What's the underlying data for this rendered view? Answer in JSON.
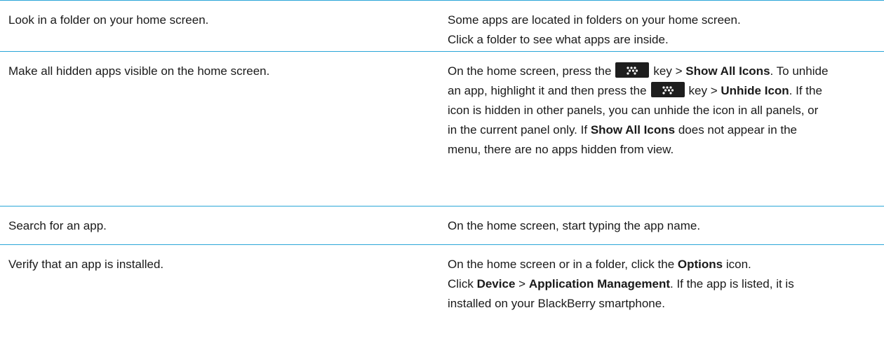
{
  "rows": [
    {
      "task": "Look in a folder on your home screen.",
      "how_l1": "Some apps are located in folders on your home screen.",
      "how_l2": "Click a folder to see what apps are inside."
    },
    {
      "task": "Make all hidden apps visible on the home screen.",
      "p1": "On the home screen, press the",
      "p2": "key >",
      "p3": "Show All Icons",
      "p4": ". To unhide an app, highlight it and then press the",
      "p5": "key >",
      "p6": "Unhide Icon",
      "p7": ". If the icon is hidden in other panels, you can unhide the icon in all panels, or in the current panel only. If",
      "p8": "Show All Icons",
      "p9": "does not appear in the menu, there are no apps hidden from view."
    },
    {
      "task": "Search for an app.",
      "how": "On the home screen, start typing the app name."
    },
    {
      "task": "Verify that an app is installed.",
      "p1": "On the home screen or in a folder, click the",
      "p2": "Options",
      "p3": "icon.",
      "p4": "Click",
      "p5": "Device",
      "p6": ">",
      "p7": "Application Management",
      "p8": ". If the app is listed, it is installed on your BlackBerry smartphone."
    }
  ],
  "icons": {
    "menu_key": "blackberry-menu-key-icon"
  },
  "colors": {
    "rule": "#2aa6d8",
    "text": "#1a1a1a",
    "key_bg": "#1e1e1e"
  }
}
